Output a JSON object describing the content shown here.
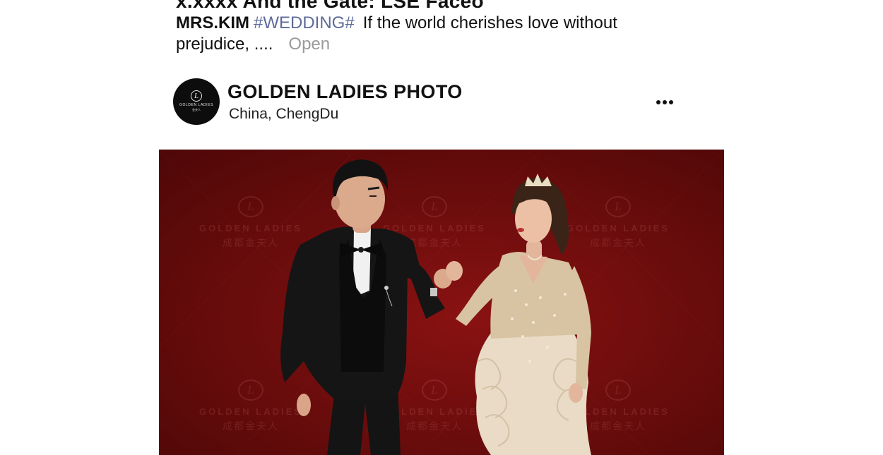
{
  "top_title_partial": "x.xxxx And the Gate: LSE Faceo",
  "caption": {
    "author": "MRS.KIM",
    "hashtag": "#WEDDING#",
    "text": "If the world cherishes love without prejudice, ....",
    "open_label": "Open"
  },
  "post": {
    "avatar": {
      "logo_letter": "L",
      "logo_text": "GOLDEN LADIES",
      "logo_sub": "金夫人"
    },
    "account_name": "GOLDEN LADIES PHOTO",
    "location": "China,  ChengDu",
    "more_icon": "more-horizontal-icon"
  },
  "photo": {
    "description_icon": "wedding-photo",
    "background_color": "#7a0e0e",
    "watermark": {
      "letter": "L",
      "name": "GOLDEN LADIES",
      "sub": "成都金夫人"
    }
  },
  "colors": {
    "hashtag": "#5e6b9a",
    "open_link": "#9a9a9a",
    "text": "#111111"
  }
}
